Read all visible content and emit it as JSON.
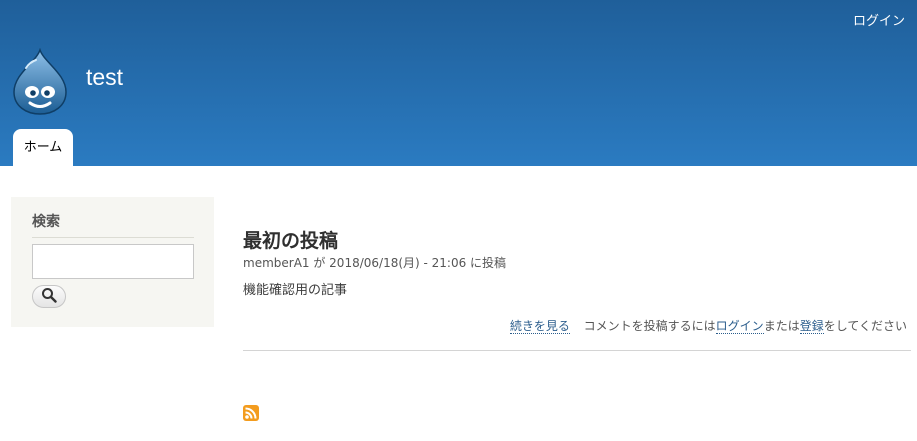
{
  "header": {
    "login_label": "ログイン",
    "site_name": "test",
    "nav": {
      "home_label": "ホーム"
    }
  },
  "sidebar": {
    "search_block": {
      "title": "検索",
      "input_value": "",
      "button_icon": "magnifier-icon"
    }
  },
  "main": {
    "node": {
      "title": "最初の投稿",
      "submitted": "memberA1 が 2018/06/18(月) - 21:06 に投稿",
      "body": "機能確認用の記事",
      "links": {
        "read_more": "続きを見る",
        "comment_prefix": "コメントを投稿するには",
        "login": "ログイン",
        "or": "または",
        "register": "登録",
        "comment_suffix": "をしてください"
      }
    },
    "feed_icon": "rss-feed-icon"
  },
  "colors": {
    "header_top": "#1f5f9a",
    "header_bottom": "#2b7bc1",
    "link": "#2b5d8c",
    "sidebar_bg": "#f6f6f2",
    "rss_orange": "#f39c1e"
  }
}
